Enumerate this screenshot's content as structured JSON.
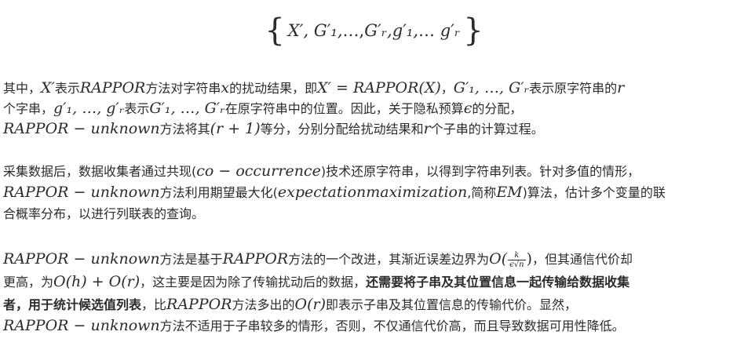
{
  "formula": {
    "x_prime": "X′,",
    "g_big": [
      "G′₁,",
      "…,",
      "G′ᵣ,"
    ],
    "g_small": [
      "g′₁,",
      "…",
      "g′ᵣ"
    ]
  },
  "para1": {
    "l1": [
      "其中，",
      "X′",
      "表示",
      "RAPPOR",
      "方法对字符串",
      "x",
      "的扰动结果，即",
      "X′ = RAPPOR(X)",
      "，",
      "G′₁, …, G′ᵣ",
      "表示原字符串的",
      "r"
    ],
    "l2": [
      "个字串，",
      "g′₁, …, g′ᵣ",
      "表示",
      "G′₁, …, G′ᵣ",
      "在原字符串中的位置。因此，关于隐私预算",
      "ϵ",
      "的分配，"
    ],
    "l3": [
      "RAPPOR − unknown",
      "方法将其",
      "(r + 1)",
      "等分，分别分配给扰动结果和",
      "r",
      "个子串的计算过程。"
    ]
  },
  "para2": {
    "l1": [
      "采集数据后，数据收集者通过共现(",
      "co − occurrence",
      ")技术还原字符串，以得到字符串列表。针对多值的情形，"
    ],
    "l2": [
      "RAPPOR − unknown",
      "方法利用期望最大化(",
      "expectationmaximization",
      ",简称",
      "EM",
      ")算法，估计多个变量的联"
    ],
    "l3": [
      "合概率分布，以进行列联表的查询。"
    ]
  },
  "para3": {
    "l1": [
      "RAPPOR − unknown",
      "方法是基于",
      "RAPPOR",
      "方法的一个改进，其渐近误差边界为",
      "O(",
      "k",
      "ϵ√n",
      ")",
      "，但其通信代价却"
    ],
    "l2": [
      "更高，为",
      "O(h) + O(r)",
      "，这主要是因为除了传输扰动后的数据，",
      "还需要将子串及其位置信息一起传输给数据收集"
    ],
    "l3": [
      "者，用于统计候选值列表",
      "，比",
      "RAPPOR",
      "方法多出的",
      "O(r)",
      "即表示子串及其位置信息的传输代价。显然，"
    ],
    "l4": [
      "RAPPOR − unknown",
      "方法不适用于子串较多的情形，否则，不仅通信代价高，而且导致数据可用性降低。"
    ]
  }
}
